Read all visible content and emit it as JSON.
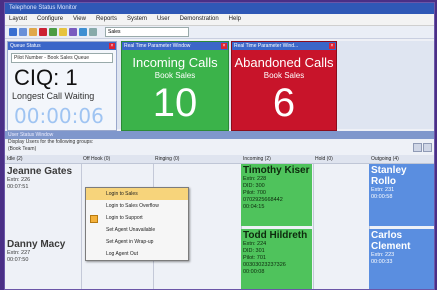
{
  "window": {
    "title": "Telephone Status Monitor"
  },
  "menu": [
    "Layout",
    "Configure",
    "View",
    "Reports",
    "System",
    "User",
    "Demonstration",
    "Help"
  ],
  "toolbar": {
    "combo": "Sales"
  },
  "queue_panel": {
    "title": "Queue Status",
    "field": "Pilot Number - Book Sales Queue",
    "ciq": "CIQ: 1",
    "lcw_label": "Longest Call Waiting",
    "timer": "00:00:06"
  },
  "green_panel": {
    "title": "Real Time Parameter Window",
    "main": "Incoming Calls",
    "sub": "Book Sales",
    "value": "10"
  },
  "red_panel": {
    "title": "Real Time Parameter Wind...",
    "main": "Abandoned Calls",
    "sub": "Book Sales",
    "value": "6"
  },
  "status_window": {
    "title": "User Status Window",
    "desc1": "Display Users for the following groups:",
    "desc2": "(Book Team)",
    "cols": [
      "Idle (2)",
      "Off Hook (0)",
      "Ringing (0)",
      "Incoming (2)",
      "Hold (0)",
      "Outgoing (4)"
    ]
  },
  "agents": {
    "idle1": {
      "name": "Jeanne Gates",
      "extn": "Extn: 226",
      "time": "00:07:51"
    },
    "idle2": {
      "name": "Danny Macy",
      "extn": "Extn: 227",
      "time": "00:07:50"
    },
    "inc1": {
      "name": "Timothy Kiser",
      "extn": "Extn: 228",
      "did": "DID: 300",
      "pilot": "Pilot: 700",
      "num": "0702925668442",
      "time": "00:04:15"
    },
    "inc2": {
      "name": "Todd Hildreth",
      "extn": "Extn: 224",
      "did": "DID: 301",
      "pilot": "Pilot: 701",
      "num": "00303023237326",
      "time": "00:00:08"
    },
    "out1": {
      "name": "Stanley Rollo",
      "extn": "Extn: 231",
      "time": "00:00:58"
    },
    "out2": {
      "name": "Carlos Clement",
      "extn": "Extn: 223",
      "time": "00:00:33"
    }
  },
  "context_menu": [
    "Login to Sales",
    "Login to Sales Overflow",
    "Login to Support",
    "Set Agent Unavailable",
    "Set Agent in Wrap-up",
    "Log Agent Out"
  ]
}
